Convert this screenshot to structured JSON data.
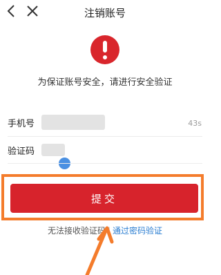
{
  "header": {
    "title": "注销账号",
    "back_icon": "chevron-left-icon",
    "close_icon": "close-icon"
  },
  "alert": {
    "icon": "exclamation-circle-icon",
    "color": "#d9262c",
    "message": "为保证账号安全，请进行安全验证"
  },
  "form": {
    "phone_label": "手机号",
    "countdown": "43s",
    "code_label": "验证码"
  },
  "submit": {
    "label": "提交",
    "color": "#d7232c"
  },
  "links": {
    "no_code": "无法接收验证码",
    "separator": "|",
    "password_verify": "通过密码验证"
  },
  "annotation": {
    "color": "#f47c2c"
  }
}
